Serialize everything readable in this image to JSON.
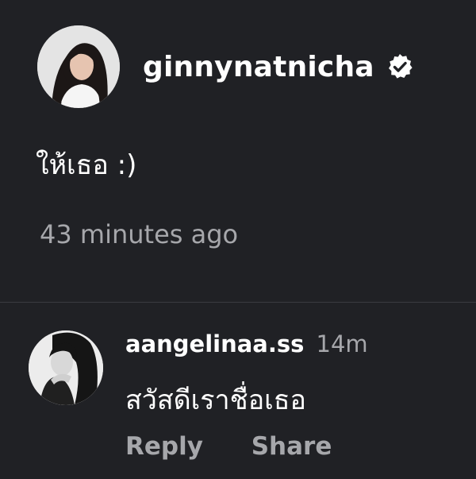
{
  "post": {
    "username": "ginnynatnicha",
    "verified": true,
    "caption": "ให้เธอ :)",
    "timestamp": "43 minutes ago"
  },
  "comment": {
    "username": "aangelinaa.ss",
    "time": "14m",
    "text": "สวัสดีเราชื่อเธอ",
    "reply_label": "Reply",
    "share_label": "Share"
  },
  "icons": {
    "verified": "verified-badge-icon"
  },
  "colors": {
    "background": "#202125",
    "primary_text": "#ffffff",
    "secondary_text": "#a6a7ab"
  }
}
